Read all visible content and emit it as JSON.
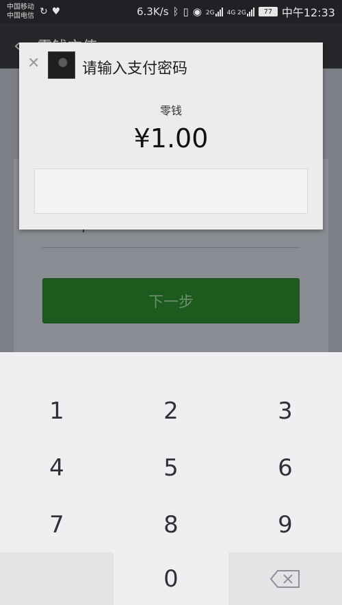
{
  "status_bar": {
    "carrier_1": "中国移动",
    "carrier_2": "中国电信",
    "net_speed": "6.3K/s",
    "sig1_label": "2G",
    "sig2_label": "4G 2G",
    "battery": "77",
    "clock": "中午12:33"
  },
  "background_page": {
    "title": "零钱充值",
    "amount_symbol": "¥",
    "next_button_label": "下一步"
  },
  "dialog": {
    "title": "请输入支付密码",
    "payment_method": "零钱",
    "amount": "¥1.00"
  },
  "keypad": {
    "keys": [
      "1",
      "2",
      "3",
      "4",
      "5",
      "6",
      "7",
      "8",
      "9",
      "",
      "0",
      ""
    ]
  },
  "colors": {
    "accent_green": "#1d5a1e",
    "overlay": "#7d7f86",
    "dialog_bg": "#ececec"
  }
}
